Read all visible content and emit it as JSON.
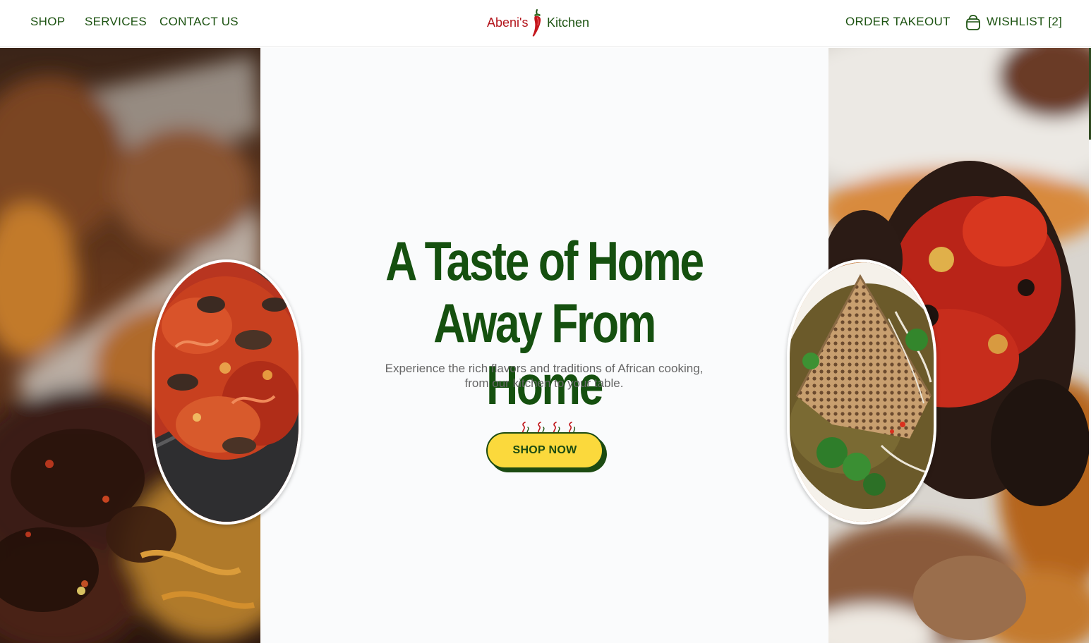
{
  "header": {
    "nav_left": [
      "SHOP",
      "SERVICES",
      "CONTACT US"
    ],
    "logo": {
      "part1": "Abeni's",
      "part2": "Kitchen"
    },
    "order_takeout": "ORDER TAKEOUT",
    "wishlist": "WISHLIST [2]"
  },
  "hero": {
    "headline_line1": "A Taste of Home",
    "headline_line2": "Away From Home",
    "subtitle": "Experience the rich flavors and traditions of African cooking, from our kitchen to your table.",
    "cta": "SHOP NOW"
  },
  "colors": {
    "brand_green": "#1d5312",
    "brand_red": "#b3141b",
    "cta_yellow": "#fbd93c",
    "hero_background": "#fafbfc"
  },
  "icons": [
    "chili-pepper-icon",
    "shopping-bag-icon",
    "steam-icon"
  ]
}
